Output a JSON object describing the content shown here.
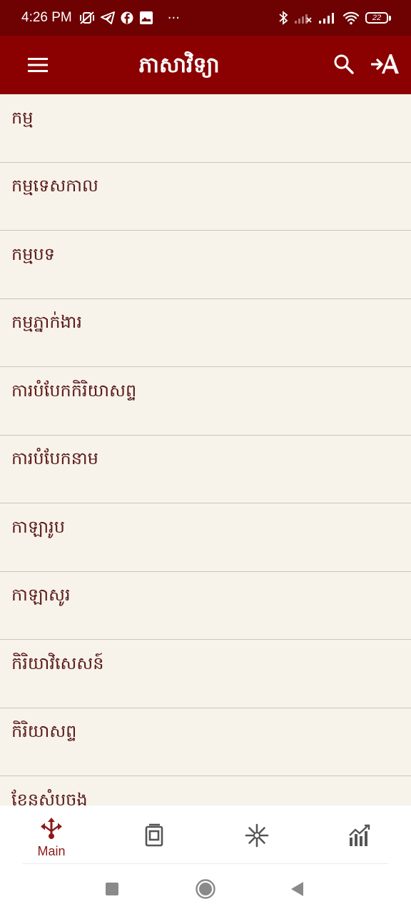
{
  "status_bar": {
    "time": "4:26 PM",
    "more": "···",
    "battery": "22",
    "icons_left": [
      "vibrate-off-icon",
      "telegram-icon",
      "facebook-icon",
      "gallery-icon"
    ],
    "icons_right": [
      "bluetooth-icon",
      "signal-off-icon",
      "signal-icon",
      "wifi-icon",
      "battery-icon"
    ]
  },
  "app_bar": {
    "title": "ភាសាវិទ្យា",
    "icons": [
      "menu-icon",
      "search-icon",
      "font-size-icon"
    ]
  },
  "list": {
    "items": [
      {
        "label": "កម្ម"
      },
      {
        "label": "កម្មទេសកាល"
      },
      {
        "label": "កម្មបទ"
      },
      {
        "label": "កម្មភ្នាក់ងារ"
      },
      {
        "label": "ការបំបែកកិរិយាសព្ទ"
      },
      {
        "label": "ការបំបែកនាម"
      },
      {
        "label": "កាឡារូប"
      },
      {
        "label": "កាឡាសូរ"
      },
      {
        "label": "កិរិយាវិសេសន៍"
      },
      {
        "label": "កិរិយាសព្ទ"
      },
      {
        "label": "ខែនសំបុចង"
      }
    ]
  },
  "bottom_nav": {
    "items": [
      {
        "label": "Main",
        "icon": "main-hub-icon",
        "active": true
      },
      {
        "label": "",
        "icon": "bookmarks-icon",
        "active": false
      },
      {
        "label": "",
        "icon": "sparkle-icon",
        "active": false
      },
      {
        "label": "",
        "icon": "stats-chart-icon",
        "active": false
      }
    ],
    "active_color": "#8b1a1a",
    "inactive_color": "#555555"
  },
  "colors": {
    "status_bar": "#6e0202",
    "app_bar": "#8b0000",
    "background": "#f7f3ea",
    "text": "#5a1a1a"
  }
}
